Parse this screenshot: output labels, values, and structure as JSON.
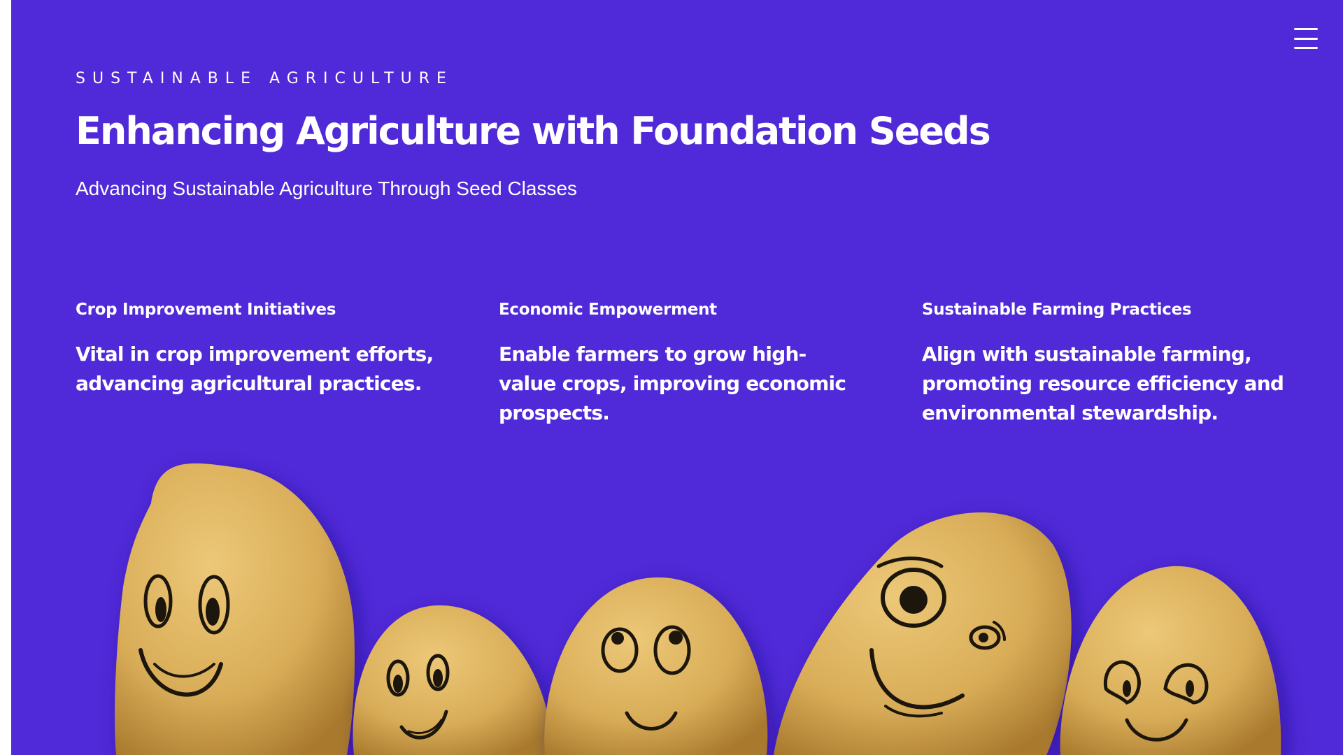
{
  "colors": {
    "background": "#5029d8",
    "text": "#ffffff",
    "potato": "#d9ad58",
    "ink": "#1a1510"
  },
  "header": {
    "menu_icon": "hamburger-menu-icon"
  },
  "hero": {
    "eyebrow": "SUSTAINABLE AGRICULTURE",
    "title": "Enhancing Agriculture with Foundation Seeds",
    "subtitle": "Advancing Sustainable Agriculture Through Seed Classes"
  },
  "features": [
    {
      "title": "Crop Improvement Initiatives",
      "text": "Vital in crop improvement efforts, advancing agricultural practices."
    },
    {
      "title": "Economic Empowerment",
      "text": "Enable farmers to grow high-value crops, improving economic prospects."
    },
    {
      "title": "Sustainable Farming Practices",
      "text": "Align with sustainable farming, promoting resource efficiency and environmental stewardship."
    }
  ]
}
